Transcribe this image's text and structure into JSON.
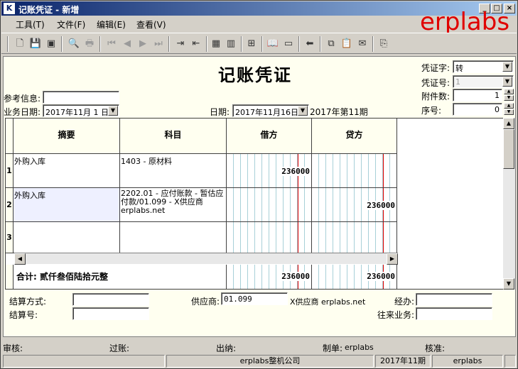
{
  "window": {
    "title": "记账凭证 - 新增",
    "app_icon": "K"
  },
  "titlebar_buttons": [
    "_",
    "□",
    "×"
  ],
  "brand": "erplabs",
  "menu": [
    {
      "label": "工具(T)"
    },
    {
      "label": "文件(F)"
    },
    {
      "label": "编辑(E)"
    },
    {
      "label": "查看(V)"
    }
  ],
  "toolbar_icons": [
    "new-icon",
    "save-icon",
    "save-all-icon",
    "print-preview-icon",
    "print-icon",
    "first-record-icon",
    "previous-record-icon",
    "next-record-icon",
    "last-record-icon",
    "insert-row-icon",
    "delete-row-icon",
    "calculator-icon",
    "ledger-icon",
    "grid-icon",
    "book-icon",
    "screen-icon",
    "back-icon",
    "copy-icon",
    "paste-icon",
    "mail-icon",
    "exit-icon"
  ],
  "form": {
    "doc_title": "记账凭证",
    "ref_label": "参考信息:",
    "ref_value": "",
    "biz_date_label": "业务日期:",
    "biz_date_value": "2017年11月 1 日",
    "date_label": "日期:",
    "date_value": "2017年11月16日",
    "period_text": "2017年第11期",
    "voucher_word_label": "凭证字:",
    "voucher_word_value": "转",
    "voucher_no_label": "凭证号:",
    "voucher_no_value": "1",
    "attachments_label": "附件数:",
    "attachments_value": "1",
    "seq_label": "序号:",
    "seq_value": "0"
  },
  "grid": {
    "headers": {
      "summary": "摘要",
      "account": "科目",
      "debit": "借方",
      "credit": "贷方"
    },
    "rows": [
      {
        "no": "1",
        "summary": "外购入库",
        "account": "1403 - 原材料",
        "debit": "236000",
        "credit": ""
      },
      {
        "no": "2",
        "summary": "外购入库",
        "account": "2202.01 - 应付账款 - 暂估应付款/01.099 - X供应商 erplabs.net",
        "debit": "",
        "credit": "236000"
      },
      {
        "no": "3",
        "summary": "",
        "account": "",
        "debit": "",
        "credit": ""
      }
    ],
    "total_label": "合计: 贰仟叁佰陆拾元整",
    "total_debit": "236000",
    "total_credit": "236000"
  },
  "footer": {
    "settle_method_label": "结算方式:",
    "settle_method_value": "",
    "settle_no_label": "结算号:",
    "settle_no_value": "",
    "supplier_label": "供应商:",
    "supplier_code": "01.099",
    "supplier_name": "X供应商 erplabs.net",
    "handler_label": "经办:",
    "handler_value": "",
    "business_label": "往来业务:",
    "business_value": ""
  },
  "signatures": {
    "audit_label": "审核:",
    "post_label": "过账:",
    "cashier_label": "出纳:",
    "maker_label": "制单:",
    "maker_value": "erplabs",
    "approve_label": "核准:"
  },
  "status": {
    "company": "erplabs整机公司",
    "period": "2017年11期",
    "user": "erplabs"
  }
}
